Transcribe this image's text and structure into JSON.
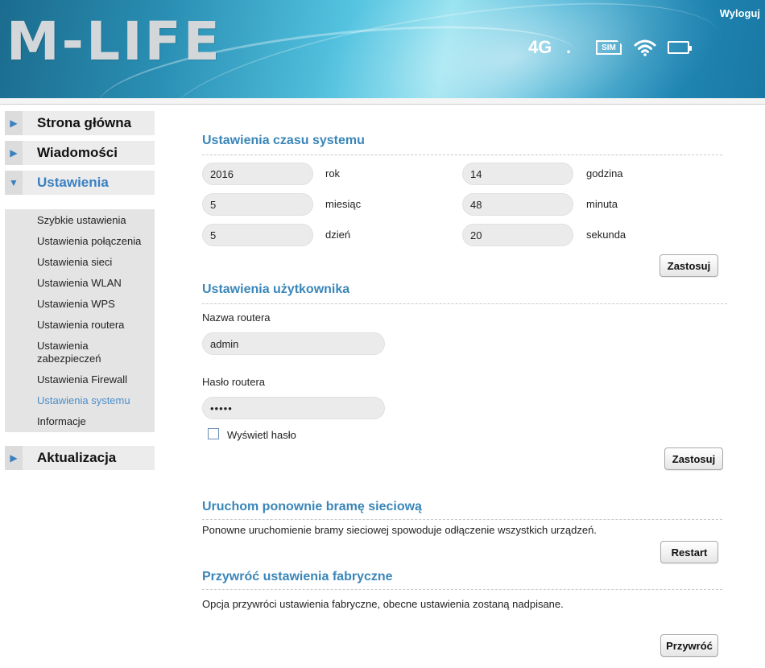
{
  "header": {
    "logo": "M-LIFE",
    "logout": "Wyloguj",
    "network_type": "4G",
    "network_dot": ".",
    "sim_label": "SIM",
    "icons": [
      "signal-text",
      "sim-icon",
      "wifi-icon",
      "battery-icon"
    ]
  },
  "sidebar": {
    "menu": [
      {
        "label": "Strona główna",
        "arrow": "▶"
      },
      {
        "label": "Wiadomości",
        "arrow": "▶"
      },
      {
        "label": "Ustawienia",
        "arrow": "▼"
      },
      {
        "label": "Aktualizacja",
        "arrow": "▶"
      }
    ],
    "submenu": [
      "Szybkie ustawienia",
      "Ustawienia połączenia",
      "Ustawienia sieci",
      "Ustawienia WLAN",
      "Ustawienia WPS",
      "Ustawienia routera",
      "Ustawienia zabezpieczeń",
      "Ustawienia Firewall",
      "Ustawienia systemu",
      "Informacje"
    ],
    "active_submenu": "Ustawienia systemu"
  },
  "time_settings": {
    "title": "Ustawienia czasu systemu",
    "year": {
      "value": "2016",
      "label": "rok"
    },
    "month": {
      "value": "5",
      "label": "miesiąc"
    },
    "day": {
      "value": "5",
      "label": "dzień"
    },
    "hour": {
      "value": "14",
      "label": "godzina"
    },
    "minute": {
      "value": "48",
      "label": "minuta"
    },
    "second": {
      "value": "20",
      "label": "sekunda"
    },
    "apply": "Zastosuj"
  },
  "user_settings": {
    "title": "Ustawienia użytkownika",
    "router_name_label": "Nazwa routera",
    "router_name_value": "admin",
    "router_password_label": "Hasło routera",
    "router_password_value": "•••••",
    "show_password_label": "Wyświetl hasło",
    "apply": "Zastosuj"
  },
  "restart": {
    "title": "Uruchom ponownie bramę sieciową",
    "description": "Ponowne uruchomienie bramy sieciowej spowoduje odłączenie wszystkich urządzeń.",
    "button": "Restart"
  },
  "factory_reset": {
    "title": "Przywróć ustawienia fabryczne",
    "description": "Opcja przywróci ustawienia fabryczne, obecne ustawienia zostaną nadpisane.",
    "button": "Przywróć"
  },
  "colors": {
    "accent": "#3a86b8",
    "menu_active": "#3a80c1",
    "submenu_active": "#4a8ec9"
  }
}
